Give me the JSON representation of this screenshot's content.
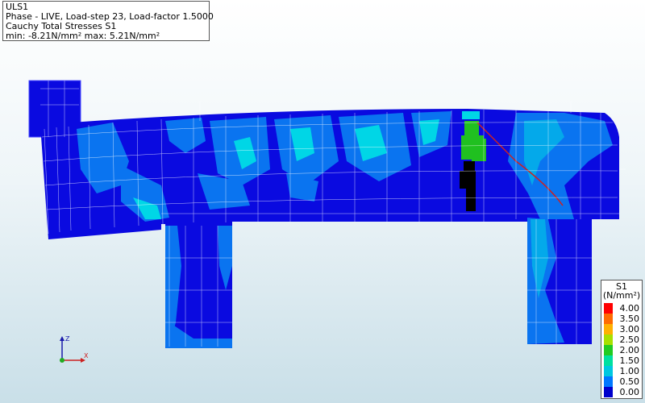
{
  "info": {
    "line1": "ULS1",
    "line2": "Phase - LIVE, Load-step 23, Load-factor 1.5000",
    "line3": "Cauchy Total Stresses S1",
    "line4": "min: -8.21N/mm² max:  5.21N/mm²"
  },
  "legend": {
    "title": "S1",
    "unit": "(N/mm²)",
    "entries": [
      {
        "label": "4.00",
        "color": "#ff0000"
      },
      {
        "label": "3.50",
        "color": "#ff6a00"
      },
      {
        "label": "3.00",
        "color": "#ffb000"
      },
      {
        "label": "2.50",
        "color": "#a8e000"
      },
      {
        "label": "2.00",
        "color": "#22cc22"
      },
      {
        "label": "1.50",
        "color": "#00e0a0"
      },
      {
        "label": "1.00",
        "color": "#00c8e0"
      },
      {
        "label": "0.50",
        "color": "#0078ff"
      },
      {
        "label": "0.00",
        "color": "#0000cc"
      }
    ]
  },
  "axes": {
    "x": "X",
    "z": "Z"
  },
  "colors": {
    "base": "#0a0ae0",
    "mid": "#0a74f0",
    "light": "#00d6e6",
    "green": "#20c020",
    "black": "#000000",
    "crack": "#cc2222",
    "mesh": "#ffffff"
  }
}
